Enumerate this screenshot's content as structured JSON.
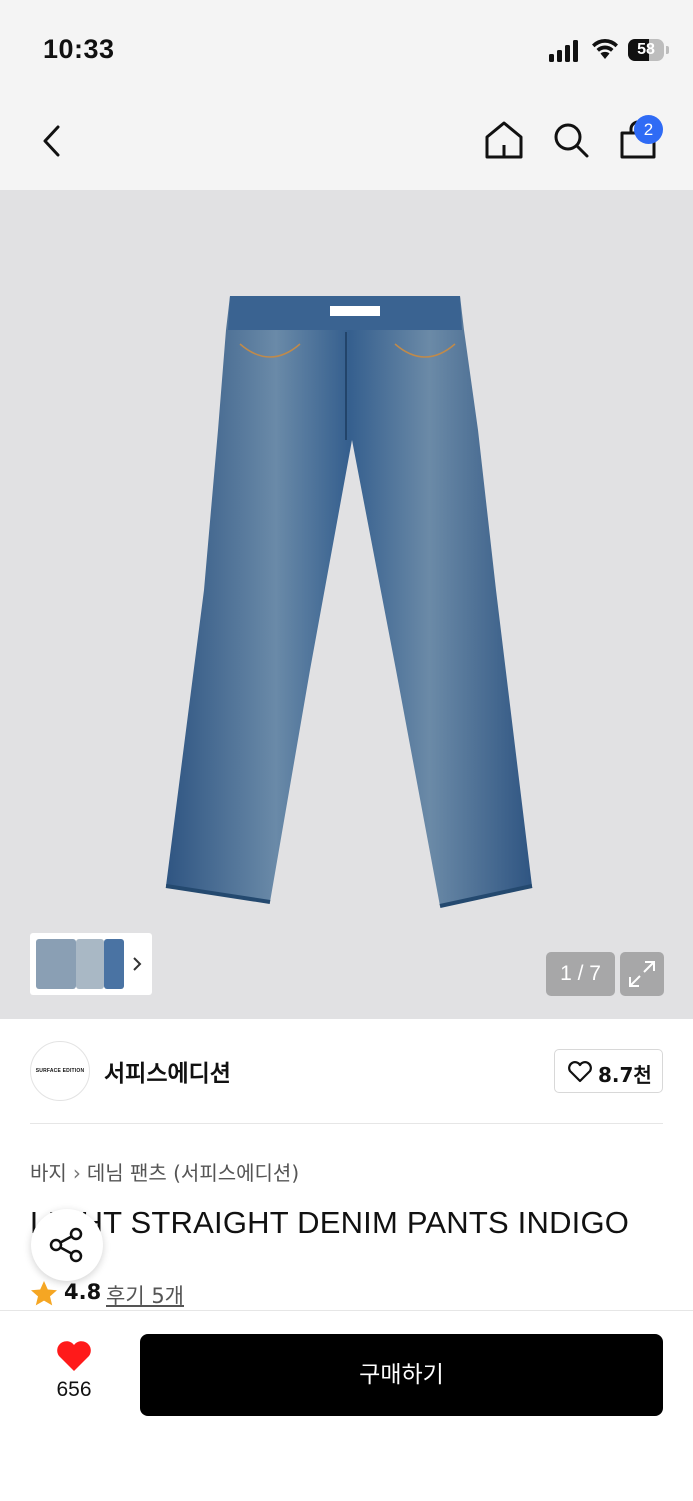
{
  "status_bar": {
    "time": "10:33",
    "battery": "58",
    "battery_level": 0.58
  },
  "nav": {
    "cart_count": "2"
  },
  "gallery": {
    "counter": "1 / 7"
  },
  "brand": {
    "logo_text": "SURFACE EDITION",
    "name": "서피스에디션",
    "likes": "8.7천"
  },
  "breadcrumb": {
    "category": "바지",
    "subcategory": "데님 팬츠 (서피스에디션)"
  },
  "product": {
    "title": "LIGHT STRAIGHT DENIM PANTS INDIGO",
    "rating": "4.8",
    "reviews": "후기 5개"
  },
  "bottom": {
    "likes": "656",
    "buy_label": "구매하기"
  },
  "colors": {
    "accent_blue": "#2f6bf5",
    "heart_red": "#ff1a1a",
    "star_orange": "#f5a623"
  }
}
